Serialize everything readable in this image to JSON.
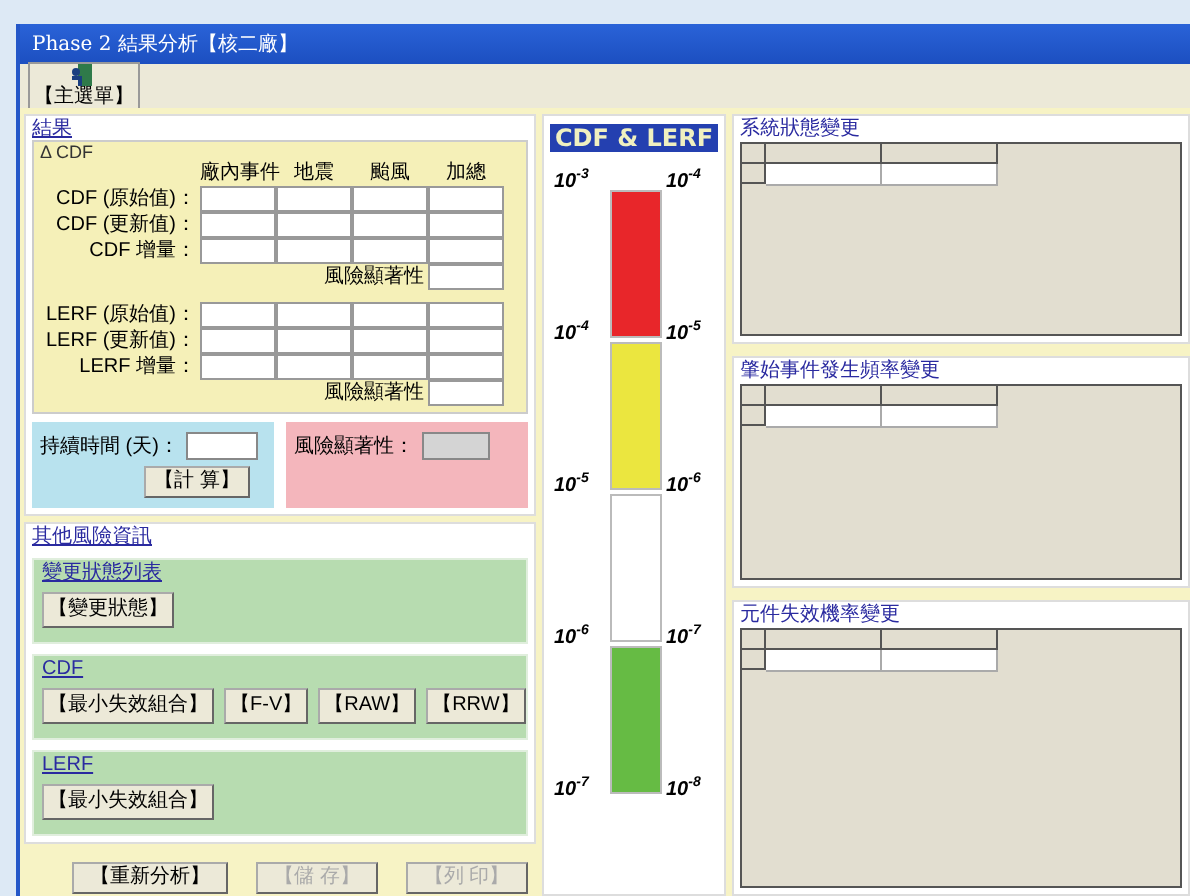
{
  "window": {
    "title": "Phase 2 結果分析【核二廠】"
  },
  "toolbar": {
    "main_menu_button": "【主選單】"
  },
  "results": {
    "title": "結果",
    "delta_cdf": {
      "title": "Δ CDF",
      "columns": [
        "廠內事件",
        "地震",
        "颱風",
        "加總"
      ],
      "blocks": [
        {
          "rows": [
            "CDF (原始值)：",
            "CDF (更新值)：",
            "CDF 增量："
          ],
          "significance_label": "風險顯著性"
        },
        {
          "rows": [
            "LERF (原始值)：",
            "LERF (更新值)：",
            "LERF 增量："
          ],
          "significance_label": "風險顯著性"
        }
      ]
    },
    "duration": {
      "label": "持續時間 (天)：",
      "button": "【計 算】"
    },
    "significance": {
      "label": "風險顯著性："
    }
  },
  "other_info": {
    "title": "其他風險資訊",
    "groups": [
      {
        "title": "變更狀態列表",
        "buttons": [
          "【變更狀態】"
        ]
      },
      {
        "title": "CDF",
        "buttons": [
          "【最小失效組合】",
          "【F-V】",
          "【RAW】",
          "【RRW】"
        ]
      },
      {
        "title": "LERF",
        "buttons": [
          "【最小失效組合】"
        ]
      }
    ]
  },
  "bottom_buttons": [
    {
      "label": "【重新分析】",
      "disabled": false
    },
    {
      "label": "【儲 存】",
      "disabled": true
    },
    {
      "label": "【列 印】",
      "disabled": true
    }
  ],
  "scale": {
    "title": "CDF & LERF",
    "bands": [
      {
        "color": "#e8262a"
      },
      {
        "color": "#ebe63f"
      },
      {
        "color": "#ffffff"
      },
      {
        "color": "#66bb44"
      }
    ],
    "ticks": [
      {
        "left": "10$^{-3}$",
        "right": "10$^{-4}$"
      },
      {
        "left": "10$^{-4}$",
        "right": "10$^{-5}$"
      },
      {
        "left": "10$^{-5}$",
        "right": "10$^{-6}$"
      },
      {
        "left": "10$^{-6}$",
        "right": "10$^{-7}$"
      },
      {
        "left": "10$^{-7}$",
        "right": "10$^{-8}$"
      }
    ]
  },
  "change_panels": [
    {
      "title": "系統狀態變更"
    },
    {
      "title": "肇始事件發生頻率變更"
    },
    {
      "title": "元件失效機率變更"
    }
  ]
}
